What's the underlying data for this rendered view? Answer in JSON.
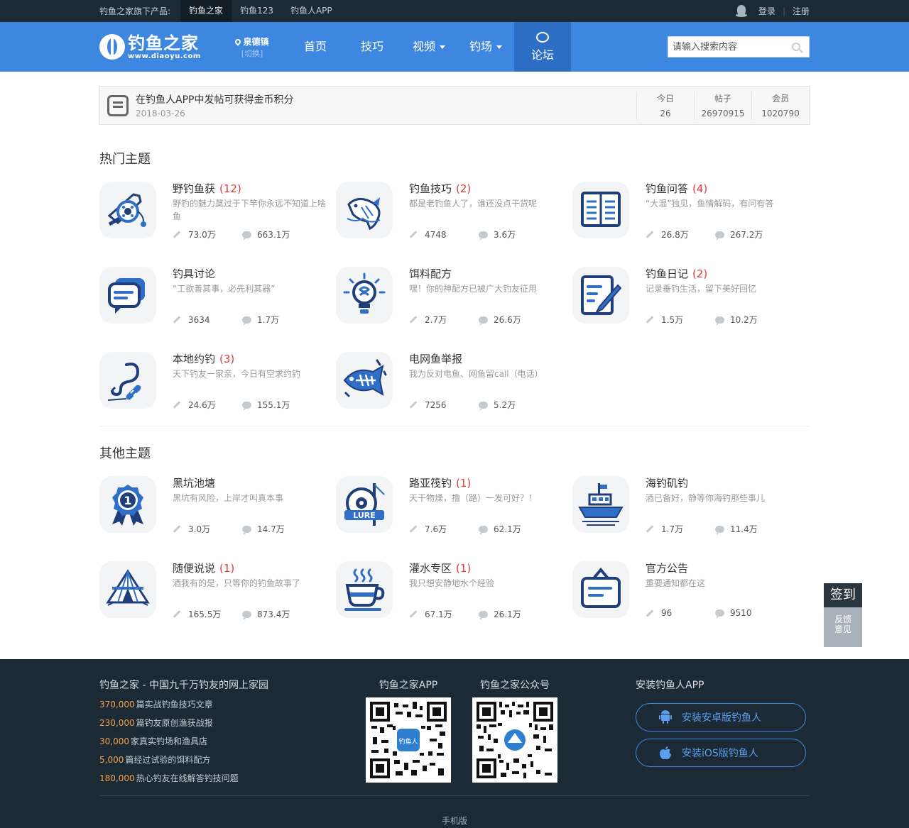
{
  "topbar": {
    "products_label": "钓鱼之家旗下产品:",
    "products": [
      {
        "label": "钓鱼之家",
        "active": true
      },
      {
        "label": "钓鱼123",
        "active": false
      },
      {
        "label": "钓鱼人APP",
        "active": false
      }
    ],
    "login": "登录",
    "register": "注册"
  },
  "header": {
    "logo_name": "钓鱼之家",
    "logo_url": "www.diaoyu.com",
    "location": "泉德镇",
    "location_switch": "[切换]",
    "nav": [
      {
        "label": "首页"
      },
      {
        "label": "技巧"
      },
      {
        "label": "视频"
      },
      {
        "label": "钓场"
      },
      {
        "label": "论坛"
      }
    ],
    "search_placeholder": "请输入搜索内容"
  },
  "notice": {
    "title": "在钓鱼人APP中发帖可获得金币积分",
    "date": "2018-03-26",
    "stats": [
      {
        "label": "今日",
        "value": "26"
      },
      {
        "label": "帖子",
        "value": "26970915"
      },
      {
        "label": "会员",
        "value": "1020790"
      }
    ]
  },
  "hot": {
    "title": "热门主题",
    "forums": [
      {
        "name": "野钓鱼获",
        "count": "(12)",
        "desc": "野钓的魅力莫过于下竿你永远不知道上啥鱼",
        "posts": "73.0万",
        "replies": "663.1万",
        "icon": "reel-icon"
      },
      {
        "name": "钓鱼技巧",
        "count": "(2)",
        "desc": "都是老钓鱼人了，谁还没点干货呢",
        "posts": "4748",
        "replies": "3.6万",
        "icon": "fish-jump-icon"
      },
      {
        "name": "钓鱼问答",
        "count": "(4)",
        "desc": "“大湿”独见，鱼情解码，有问有答",
        "posts": "26.8万",
        "replies": "267.2万",
        "icon": "book-icon"
      },
      {
        "name": "钓具讨论",
        "count": "",
        "desc": "“工欲善其事，必先利其器”",
        "posts": "3634",
        "replies": "1.7万",
        "icon": "chat-icon"
      },
      {
        "name": "饵料配方",
        "count": "",
        "desc": "嘿！你的神配方已被广大钓友征用",
        "posts": "2.7万",
        "replies": "26.6万",
        "icon": "bulb-icon"
      },
      {
        "name": "钓鱼日记",
        "count": "(2)",
        "desc": "记录垂钓生活，留下美好回忆",
        "posts": "1.5万",
        "replies": "10.2万",
        "icon": "diary-icon"
      },
      {
        "name": "本地约钓",
        "count": "(3)",
        "desc": "天下钓友一家亲，今日有空求约钓",
        "posts": "24.6万",
        "replies": "155.1万",
        "icon": "hook-icon"
      },
      {
        "name": "电网鱼举报",
        "count": "",
        "desc": "我为反对电鱼、网鱼留call（电话）",
        "posts": "7256",
        "replies": "5.2万",
        "icon": "fishbone-icon"
      }
    ]
  },
  "other": {
    "title": "其他主题",
    "forums": [
      {
        "name": "黑坑池塘",
        "count": "",
        "desc": "黑坑有风险，上岸才叫真本事",
        "posts": "3.0万",
        "replies": "14.7万",
        "icon": "medal-icon"
      },
      {
        "name": "路亚筏钓",
        "count": "(1)",
        "desc": "天干物燥，撸（路）一发可好？！",
        "posts": "7.6万",
        "replies": "62.1万",
        "icon": "lure-icon"
      },
      {
        "name": "海钓矶钓",
        "count": "",
        "desc": "酒已备好，静等你海钓那些事儿",
        "posts": "1.7万",
        "replies": "11.4万",
        "icon": "boat-icon"
      },
      {
        "name": "随便说说",
        "count": "(1)",
        "desc": "酒我有的是，只等你的钓鱼故事了",
        "posts": "165.5万",
        "replies": "873.4万",
        "icon": "tent-icon"
      },
      {
        "name": "灌水专区",
        "count": "(1)",
        "desc": "我只想安静地水个经验",
        "posts": "67.1万",
        "replies": "26.1万",
        "icon": "cup-icon"
      },
      {
        "name": "官方公告",
        "count": "",
        "desc": "重要通知都在这",
        "posts": "96",
        "replies": "9510",
        "icon": "board-icon"
      }
    ]
  },
  "float": {
    "sign": "签到",
    "feedback_line1": "反馈",
    "feedback_line2": "意见"
  },
  "footer": {
    "title": "钓鱼之家 - 中国九千万钓友的网上家园",
    "rows": [
      {
        "num": "370,000",
        "text": "篇实战钓鱼技巧文章"
      },
      {
        "num": "230,000",
        "text": "篇钓友原创渔获战报"
      },
      {
        "num": "30,000",
        "text": "家真实钓场和渔具店"
      },
      {
        "num": "5,000",
        "text": "篇经过试验的饵料配方"
      },
      {
        "num": "180,000",
        "text": "热心钓友在线解答钓技问题"
      }
    ],
    "qr1_title": "钓鱼之家APP",
    "qr1_center": "钓鱼人",
    "qr2_title": "钓鱼之家公众号",
    "install_title": "安装钓鱼人APP",
    "android_btn": "安装安卓版钓鱼人",
    "ios_btn": "安装iOS版钓鱼人",
    "mobile": "手机版"
  },
  "colors": {
    "brand_blue": "#3e87e0",
    "nav_active": "#2d6fc4",
    "dark_bg": "#1c2a36",
    "count_red": "#e23c3c",
    "footer_number": "#f0a24a",
    "icon_blue": "#2f6fc7",
    "icon_navy": "#1f3e7a"
  }
}
